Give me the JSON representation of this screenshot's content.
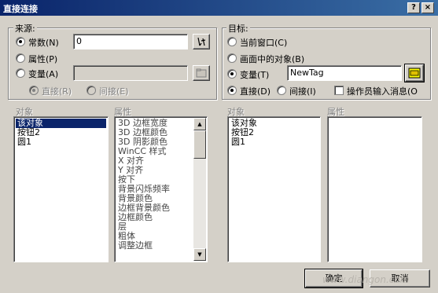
{
  "window": {
    "title": "直接连接",
    "help_button": "?",
    "close_button": "×"
  },
  "source": {
    "legend": "来源:",
    "constant_label": "常数(N)",
    "constant_value": "0",
    "property_label": "属性(P)",
    "variable_label": "变量(A)",
    "variable_value": "",
    "direct_label": "直接(R)",
    "indirect_label": "间接(E)",
    "objects_header": "对象",
    "properties_header": "属性",
    "objects": [
      "该对象",
      "按钮2",
      "圆1"
    ],
    "selected_object": 0,
    "properties": [
      "3D 边框宽度",
      "3D 边框颜色",
      "3D 阴影颜色",
      "WinCC 样式",
      "X 对齐",
      "Y 对齐",
      "按下",
      "背景闪烁频率",
      "背景颜色",
      "边框背景颜色",
      "边框颜色",
      "层",
      "粗体",
      "调整边框"
    ]
  },
  "target": {
    "legend": "目标:",
    "current_window_label": "当前窗口(C)",
    "object_in_screen_label": "画面中的对象(B)",
    "variable_label": "变量(T)",
    "variable_value": "NewTag",
    "direct_label": "直接(D)",
    "indirect_label": "间接(I)",
    "operator_message_label": "操作员输入消息(O",
    "objects_header": "对象",
    "properties_header": "属性",
    "objects": [
      "该对象",
      "按钮2",
      "圆1"
    ]
  },
  "buttons": {
    "ok": "确定",
    "cancel": "取消"
  },
  "watermark": "www.diangon.com"
}
